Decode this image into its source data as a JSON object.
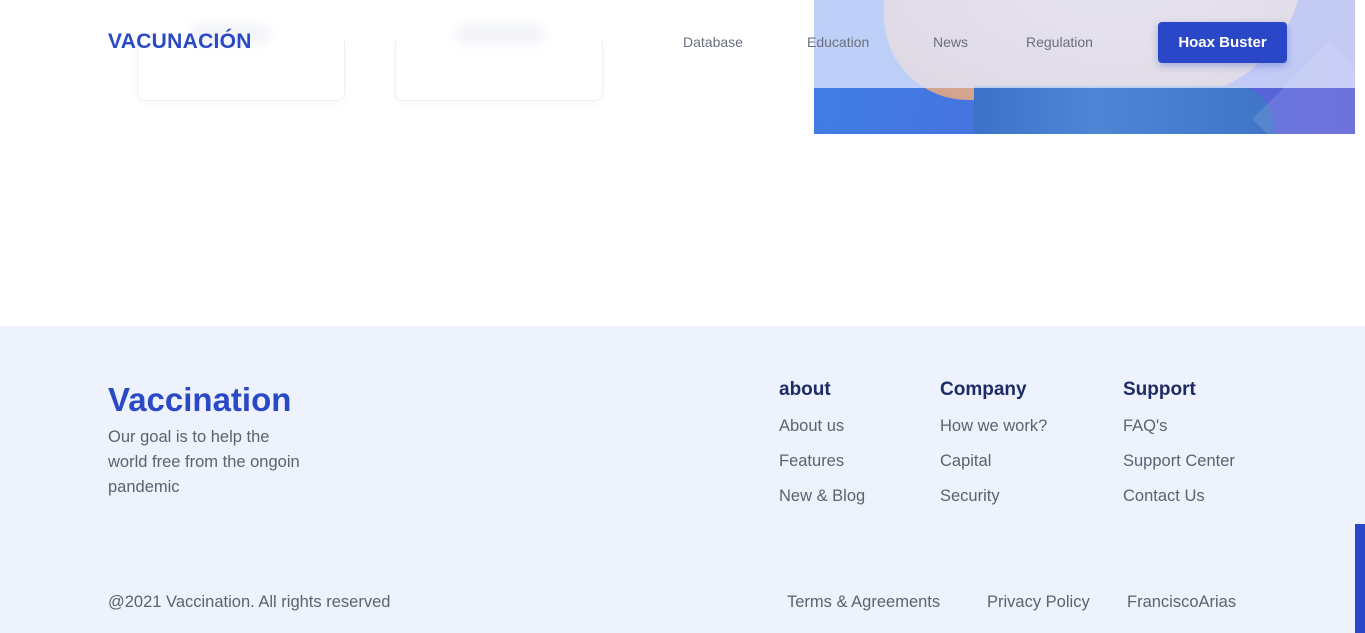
{
  "header": {
    "logo": "VACUNACIÓN",
    "nav": [
      "Database",
      "Education",
      "News",
      "Regulation"
    ],
    "cta_label": "Hoax Buster"
  },
  "footer": {
    "brand": "Vaccination",
    "tagline": "Our goal is to help the world free from the ongoin pandemic",
    "columns": [
      {
        "title": "about",
        "links": [
          "About us",
          "Features",
          "New & Blog"
        ]
      },
      {
        "title": "Company",
        "links": [
          "How we work?",
          "Capital",
          "Security"
        ]
      },
      {
        "title": "Support",
        "links": [
          "FAQ's",
          "Support Center",
          "Contact Us"
        ]
      }
    ],
    "copyright": "@2021 Vaccination. All rights reserved",
    "legal_links": [
      "Terms & Agreements",
      "Privacy Policy",
      "FranciscoArias"
    ]
  },
  "colors": {
    "brand_blue": "#2a49c5",
    "footer_bg": "#edf2fd",
    "heading_navy": "#1e2c66",
    "body_text": "#5d6271"
  }
}
